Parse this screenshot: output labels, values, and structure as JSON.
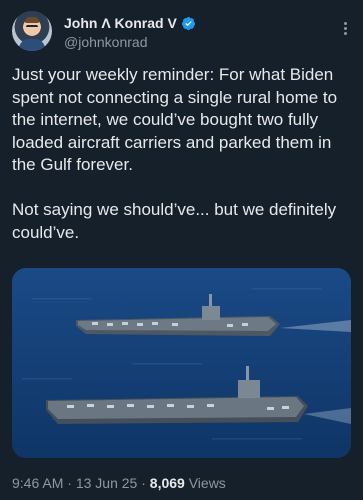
{
  "author": {
    "display_name": "John Λ Konrad V",
    "handle": "@johnkonrad",
    "verified": true
  },
  "tweet": {
    "text": "Just your weekly reminder: For what Biden spent not connecting a single rural home to the internet, we could’ve bought two fully loaded aircraft carriers and parked them in the Gulf forever.\n\nNot saying we should’ve... but we definitely could’ve.",
    "time": "9:46 AM",
    "date": "13 Jun 25",
    "sep": "·",
    "views_count": "8,069",
    "views_label": "Views"
  },
  "colors": {
    "background": "#15202b",
    "text": "#e7e9ea",
    "secondary": "#8b98a5",
    "verified": "#1d9bf0"
  },
  "icons": {
    "verified": "verified-badge-icon",
    "more": "more-options-icon"
  }
}
